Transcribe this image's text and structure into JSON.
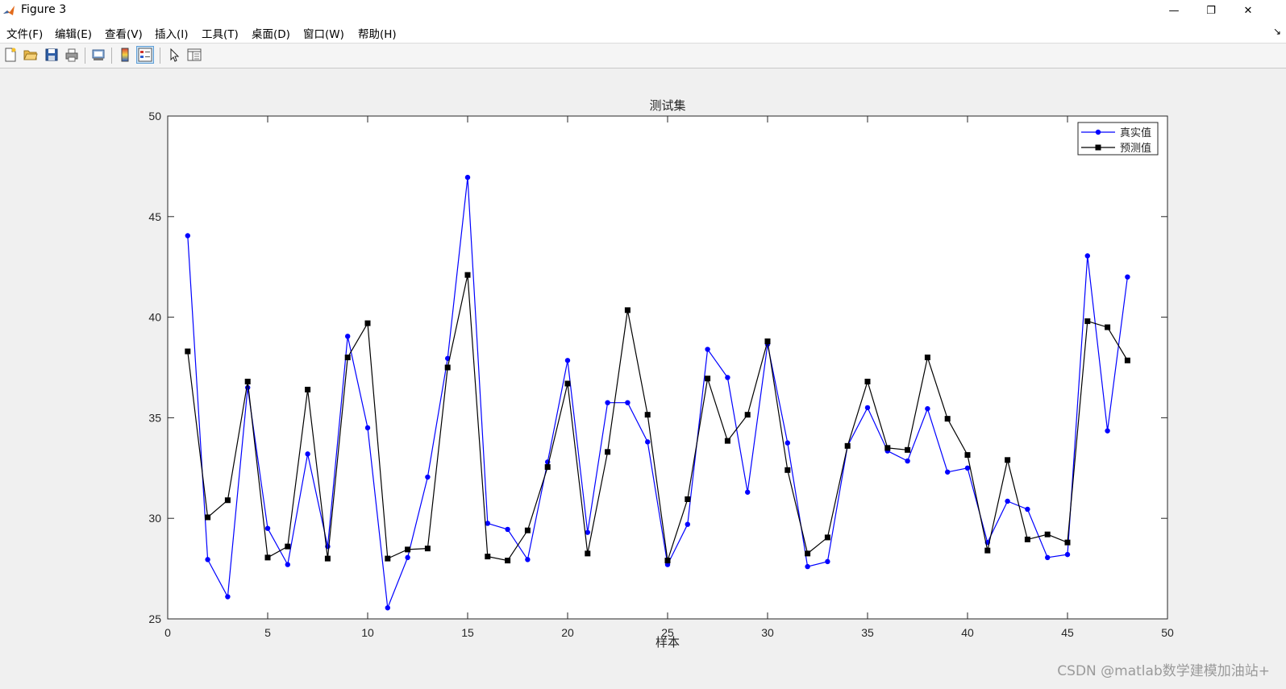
{
  "window": {
    "title": "Figure 3",
    "minimize_glyph": "—",
    "maximize_glyph": "❐",
    "close_glyph": "✕"
  },
  "menu": {
    "items": [
      "文件(F)",
      "编辑(E)",
      "查看(V)",
      "插入(I)",
      "工具(T)",
      "桌面(D)",
      "窗口(W)",
      "帮助(H)"
    ],
    "overflow_glyph": "↘"
  },
  "toolbar": {
    "buttons": [
      "new-figure-icon",
      "open-file-icon",
      "save-icon",
      "print-icon",
      "print-preview-icon",
      "colorbar-icon",
      "legend-icon",
      "pointer-icon",
      "property-inspector-icon"
    ]
  },
  "chart_data": {
    "type": "line",
    "title": "测试集",
    "xlabel": "样本",
    "ylabel": "",
    "xlim": [
      0,
      50
    ],
    "ylim": [
      25,
      50
    ],
    "xticks": [
      0,
      5,
      10,
      15,
      20,
      25,
      30,
      35,
      40,
      45,
      50
    ],
    "yticks": [
      25,
      30,
      35,
      40,
      45,
      50
    ],
    "legend_position": "top-right",
    "x": [
      1,
      2,
      3,
      4,
      5,
      6,
      7,
      8,
      9,
      10,
      11,
      12,
      13,
      14,
      15,
      16,
      17,
      18,
      19,
      20,
      21,
      22,
      23,
      24,
      25,
      26,
      27,
      28,
      29,
      30,
      31,
      32,
      33,
      34,
      35,
      36,
      37,
      38,
      39,
      40,
      41,
      42,
      43,
      44,
      45,
      46,
      47,
      48
    ],
    "series": [
      {
        "name": "真实值",
        "color": "#0000ff",
        "marker": "circle",
        "values": [
          44.05,
          27.95,
          26.1,
          36.5,
          29.5,
          27.7,
          33.2,
          28.6,
          39.05,
          34.5,
          25.55,
          28.05,
          32.05,
          37.95,
          46.95,
          29.75,
          29.45,
          27.95,
          32.8,
          37.85,
          29.3,
          35.75,
          35.75,
          33.8,
          27.7,
          29.7,
          38.4,
          37.0,
          31.3,
          38.65,
          33.75,
          27.6,
          27.85,
          33.6,
          35.5,
          33.35,
          32.85,
          35.45,
          32.3,
          32.5,
          28.8,
          30.85,
          30.45,
          28.05,
          28.2,
          43.05,
          34.35,
          42.0
        ]
      },
      {
        "name": "预测值",
        "color": "#000000",
        "marker": "square",
        "values": [
          38.3,
          30.05,
          30.9,
          36.8,
          28.05,
          28.6,
          36.4,
          28.0,
          38.0,
          39.7,
          28.0,
          28.45,
          28.5,
          37.5,
          42.1,
          28.1,
          27.9,
          29.4,
          32.55,
          36.7,
          28.25,
          33.3,
          40.35,
          35.15,
          27.9,
          30.95,
          36.95,
          33.85,
          35.15,
          38.8,
          32.4,
          28.25,
          29.05,
          33.6,
          36.8,
          33.5,
          33.4,
          38.0,
          34.95,
          33.15,
          28.4,
          32.9,
          28.95,
          29.2,
          28.8,
          39.8,
          39.5,
          37.85
        ]
      }
    ]
  },
  "watermark": "CSDN @matlab数学建模加油站+"
}
